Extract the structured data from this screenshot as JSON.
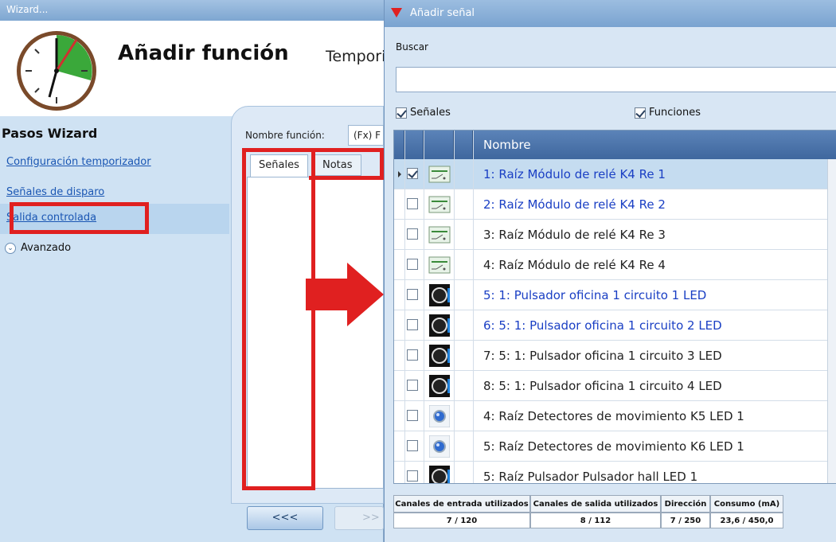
{
  "wizard": {
    "window_title": "Wizard...",
    "title": "Añadir función",
    "subtitle": "Temporizador",
    "steps_title": "Pasos Wizard",
    "steps": [
      {
        "label": "Configuración temporizador"
      },
      {
        "label": "Señales de disparo"
      },
      {
        "label": "Salida controlada"
      }
    ],
    "advanced_label": "Avanzado",
    "function_name_label": "Nombre función:",
    "function_name_value": "(Fx) F",
    "tabs": [
      "Señales",
      "Notas"
    ],
    "nav_prev": "<<<",
    "nav_next": ">>"
  },
  "dialog": {
    "title": "Añadir señal",
    "search_label": "Buscar",
    "search_value": "",
    "filter_signals": "Señales",
    "filter_functions": "Funciones",
    "column_name": "Nombre",
    "rows": [
      {
        "name": "1: Raíz Módulo de relé K4 Re 1",
        "icon": "relay-icon",
        "checked": true,
        "color": "#1a3fc4"
      },
      {
        "name": "2: Raíz Módulo de relé K4 Re 2",
        "icon": "relay-icon",
        "checked": false,
        "color": "#1a3fc4"
      },
      {
        "name": "3: Raíz Módulo de relé K4 Re 3",
        "icon": "relay-icon",
        "checked": false,
        "color": "#222222"
      },
      {
        "name": "4: Raíz Módulo de relé K4 Re 4",
        "icon": "relay-icon",
        "checked": false,
        "color": "#222222"
      },
      {
        "name": "5: 1: Pulsador oficina 1 circuito 1 LED",
        "icon": "pushbutton-icon",
        "checked": false,
        "color": "#1a3fc4"
      },
      {
        "name": "6: 5: 1: Pulsador oficina 1 circuito 2 LED",
        "icon": "pushbutton-icon",
        "checked": false,
        "color": "#1a3fc4"
      },
      {
        "name": "7: 5: 1: Pulsador oficina 1 circuito 3 LED",
        "icon": "pushbutton-icon",
        "checked": false,
        "color": "#222222"
      },
      {
        "name": "8: 5: 1: Pulsador oficina 1 circuito 4 LED",
        "icon": "pushbutton-icon",
        "checked": false,
        "color": "#222222"
      },
      {
        "name": "4: Raíz Detectores de movimiento K5 LED 1",
        "icon": "motion-detector-icon",
        "checked": false,
        "color": "#222222"
      },
      {
        "name": "5: Raíz Detectores de movimiento K6 LED 1",
        "icon": "motion-detector-icon",
        "checked": false,
        "color": "#222222"
      },
      {
        "name": "5: Raíz Pulsador Pulsador hall LED 1",
        "icon": "pushbutton-icon",
        "checked": false,
        "color": "#222222"
      }
    ],
    "status": {
      "headers": [
        "Canales de entrada utilizados",
        "Canales de salida utilizados",
        "Dirección",
        "Consumo (mA)"
      ],
      "values": [
        "7 / 120",
        "8 / 112",
        "7 / 250",
        "23,6 / 450,0"
      ]
    }
  },
  "colors": {
    "highlight": "#e02020",
    "link": "#1a56b3"
  }
}
